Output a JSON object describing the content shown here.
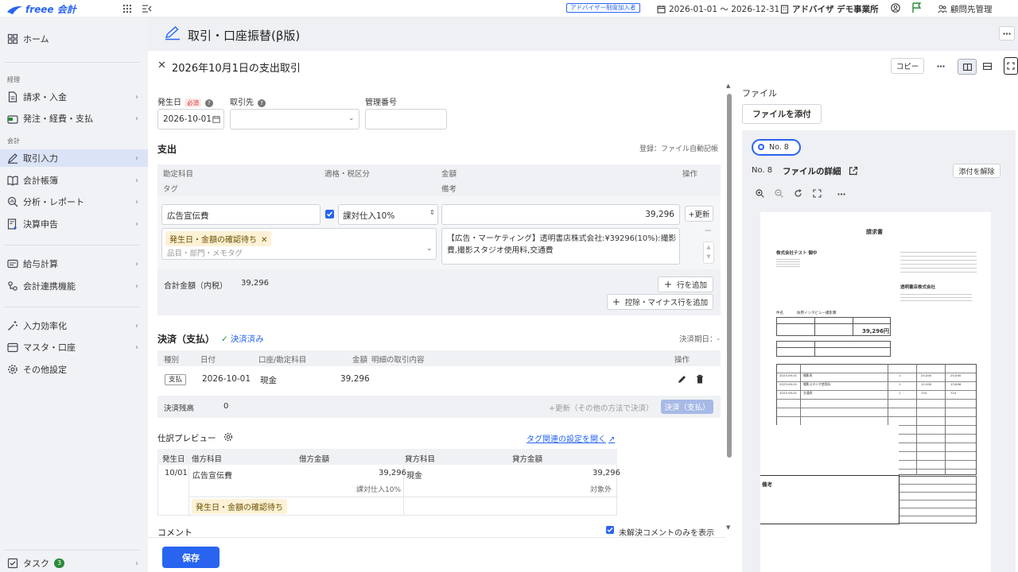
{
  "topbar": {
    "logo_text": "freee 会計",
    "advisor_badge": "アドバイザー制度加入者",
    "period": "2026-01-01 〜 2026-12-31",
    "company": "アドバイザ デモ事業所",
    "client_mgmt": "顧問先管理"
  },
  "sidebar": {
    "home": "ホーム",
    "section_keiri": "経理",
    "section_kaikei": "会計",
    "items": {
      "seikyu": "請求・入金",
      "hacchu": "発注・経費・支払",
      "torihiki": "取引入力",
      "chobo": "会計帳簿",
      "bunseki": "分析・レポート",
      "kessan": "決算申告",
      "kyuyo": "給与計算",
      "renkei": "会計連携機能",
      "koritsu": "入力効率化",
      "master": "マスタ・口座",
      "sonota": "その他設定"
    },
    "task_label": "タスク",
    "task_count": "3"
  },
  "page": {
    "title": "取引・口座振替(β版)",
    "sub_title": "2026年10月1日の支出取引",
    "copy_label": "コピー"
  },
  "form": {
    "date_label": "発生日",
    "required": "必須",
    "partner_label": "取引先",
    "ref_label": "管理番号",
    "date_value": "2026-10-01"
  },
  "expense": {
    "title": "支出",
    "registered": "登録：ファイル自動記帳",
    "headers": {
      "account": "勘定科目",
      "tax": "適格・税区分",
      "amount": "金額",
      "ops": "操作",
      "tag": "タグ",
      "note": "備考"
    },
    "account_value": "広告宣伝費",
    "tax_value": "課対仕入10%",
    "amount_value": "39,296",
    "update_label": "+更新",
    "pending_tag": "発生日・金額の確認待ち",
    "tag_placeholder": "品目・部門・メモタグ",
    "note_value": "【広告・マーケティング】透明書店株式会社:¥39296(10%):撮影費,撮影スタジオ使用料,交通費",
    "total_label": "合計金額（内税）",
    "total_value": "39,296",
    "add_row": "行を追加",
    "add_deduction": "控除・マイナス行を追加"
  },
  "payment": {
    "title": "決済（支払）",
    "status": "決済済み",
    "due_label": "決済期日：-",
    "headers": {
      "type": "種別",
      "date": "日付",
      "account": "口座/勘定科目",
      "amount": "金額",
      "detail": "明細の取引内容",
      "ops": "操作"
    },
    "row": {
      "type": "支払",
      "date": "2026-10-01",
      "account": "現金",
      "amount": "39,296"
    },
    "balance_label": "決済残高",
    "balance_value": "0",
    "update_other": "+更新（その他の方法で決済）",
    "pay_button": "決済（支払）"
  },
  "journal": {
    "title": "仕訳プレビュー",
    "tag_link": "タグ関連の設定を開く",
    "headers": {
      "date": "発生日",
      "debit_account": "借方科目",
      "debit_amount": "借方金額",
      "credit_account": "貸方科目",
      "credit_amount": "貸方金額"
    },
    "row": {
      "date": "10/01",
      "debit_account": "広告宣伝費",
      "debit_amount": "39,296",
      "debit_tax": "課対仕入10%",
      "credit_account": "現金",
      "credit_amount": "39,296",
      "credit_tax": "対象外"
    },
    "pending_tag": "発生日・金額の確認待ち"
  },
  "comment": {
    "title": "コメント",
    "unresolved": "未解決コメントのみを表示"
  },
  "save_label": "保存",
  "files": {
    "title": "ファイル",
    "attach": "ファイルを添付",
    "chip": "No. 8",
    "detail_no": "No. 8",
    "detail_title": "ファイルの詳細",
    "detach": "添付を解除"
  },
  "invoice": {
    "title": "請求書",
    "to": "株式会社テスト 御中",
    "from": "透明書店株式会社",
    "subject_label": "件名",
    "subject": "採用インタビュー撮影費",
    "total": "39,296円",
    "notes_label": "備考",
    "line_items": [
      {
        "date": "2023-09-01",
        "name": "撮影費",
        "qty": "1",
        "unit": "25,000",
        "amount": "25,000"
      },
      {
        "date": "2023-09-01",
        "name": "撮影スタジオ使用料",
        "qty": "1",
        "unit": "12,000",
        "amount": "13,606"
      },
      {
        "date": "2023-09-01",
        "name": "交通費",
        "qty": "1",
        "unit": "724",
        "amount": "724"
      }
    ]
  }
}
